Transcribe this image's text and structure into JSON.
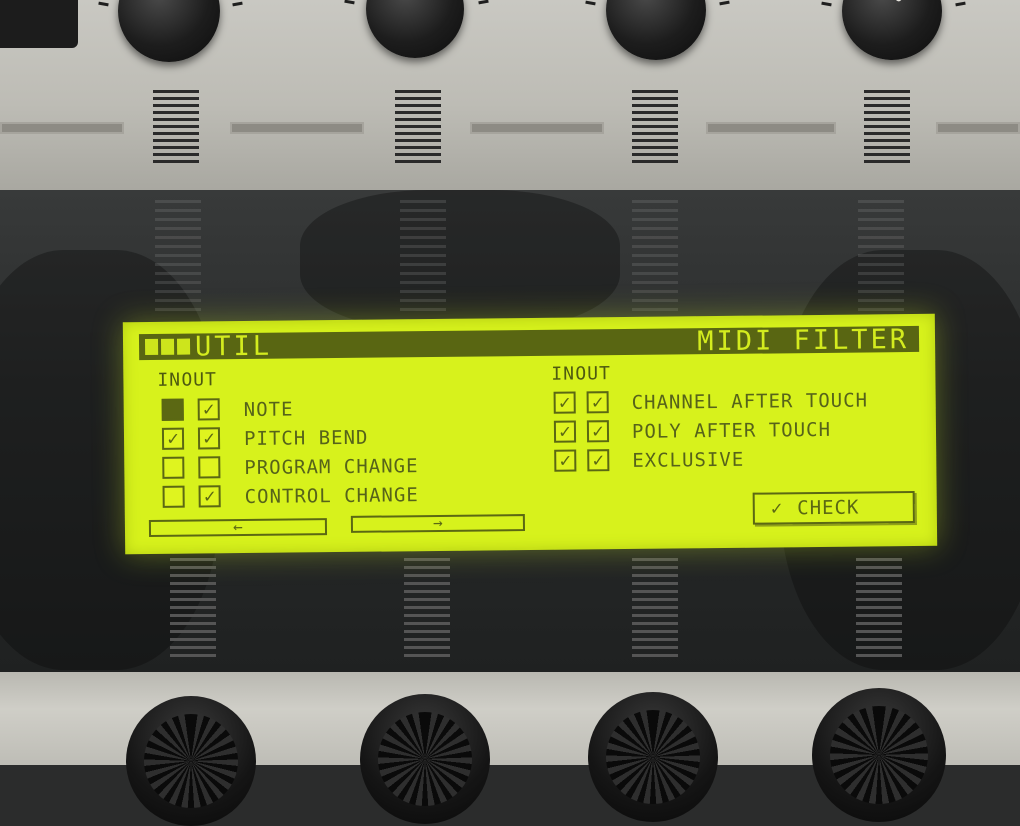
{
  "title_bar": {
    "section": "UTIL",
    "page": "MIDI FILTER"
  },
  "columns": {
    "in": "IN",
    "out": "OUT"
  },
  "check_glyph": "✓",
  "left_rows": [
    {
      "label": "NOTE",
      "in": "selected",
      "out": true
    },
    {
      "label": "PITCH BEND",
      "in": true,
      "out": true
    },
    {
      "label": "PROGRAM CHANGE",
      "in": false,
      "out": false
    },
    {
      "label": "CONTROL CHANGE",
      "in": false,
      "out": true
    }
  ],
  "right_rows": [
    {
      "label": "CHANNEL AFTER TOUCH",
      "in": true,
      "out": true
    },
    {
      "label": "POLY AFTER TOUCH",
      "in": true,
      "out": true
    },
    {
      "label": "EXCLUSIVE",
      "in": true,
      "out": true
    }
  ],
  "nav": {
    "prev_glyph": "←",
    "next_glyph": "→"
  },
  "check_button": {
    "glyph": "✓",
    "label": "CHECK"
  },
  "colors": {
    "lcd_background": "#d7f21c",
    "lcd_ink": "#5b6813"
  }
}
